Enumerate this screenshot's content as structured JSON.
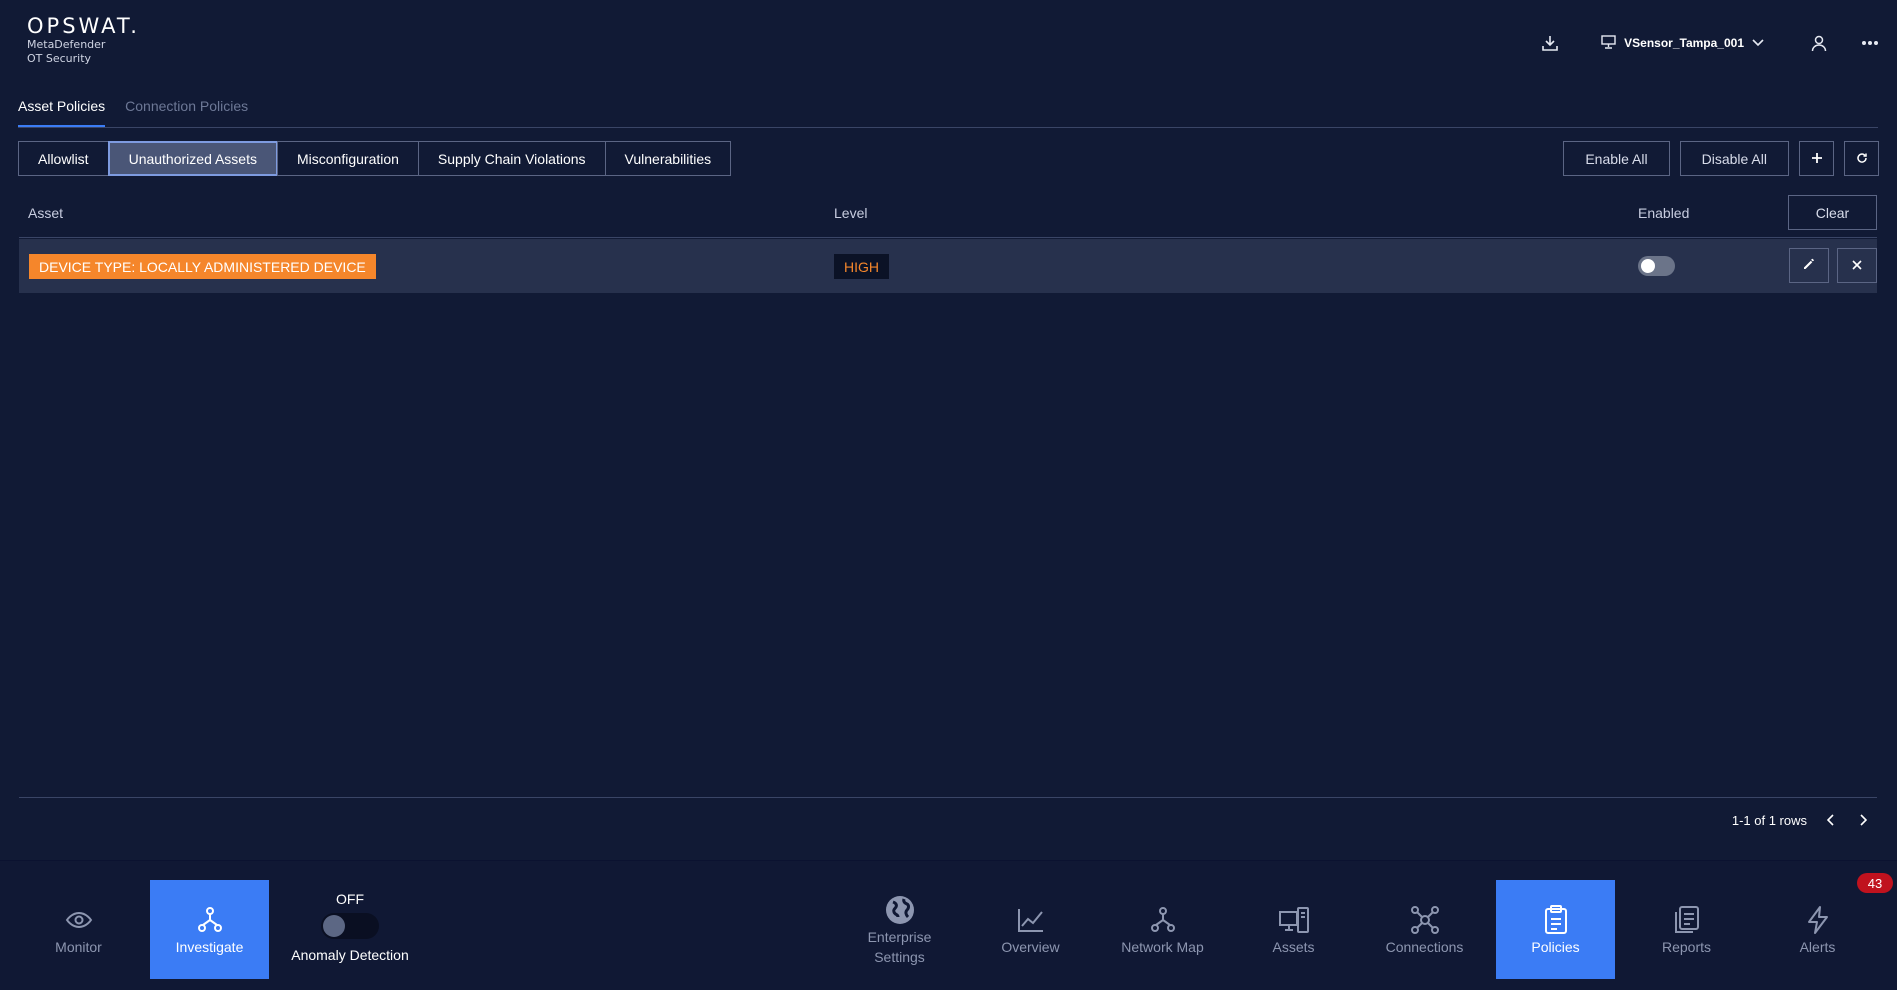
{
  "brand": {
    "name": "OPSWAT.",
    "product_line1": "MetaDefender",
    "product_line2": "OT Security"
  },
  "header": {
    "sensor_name": "VSensor_Tampa_001",
    "icons": [
      "download-icon",
      "monitor-icon",
      "chevron-down-icon",
      "user-icon",
      "more-icon"
    ]
  },
  "tabs": [
    {
      "label": "Asset Policies",
      "active": true
    },
    {
      "label": "Connection Policies",
      "active": false
    }
  ],
  "filters": [
    {
      "label": "Allowlist",
      "active": false
    },
    {
      "label": "Unauthorized Assets",
      "active": true
    },
    {
      "label": "Misconfiguration",
      "active": false
    },
    {
      "label": "Supply Chain Violations",
      "active": false
    },
    {
      "label": "Vulnerabilities",
      "active": false
    }
  ],
  "actions": {
    "enable_all": "Enable All",
    "disable_all": "Disable All",
    "add_icon": "plus-icon",
    "refresh_icon": "refresh-icon"
  },
  "table": {
    "columns": {
      "asset": "Asset",
      "level": "Level",
      "enabled": "Enabled"
    },
    "clear_label": "Clear",
    "rows": [
      {
        "asset": "DEVICE TYPE: LOCALLY ADMINISTERED DEVICE",
        "level": "HIGH",
        "enabled": false
      }
    ]
  },
  "pagination": {
    "text": "1-1 of 1 rows"
  },
  "nav": {
    "monitor": "Monitor",
    "investigate": "Investigate",
    "anomaly_state": "OFF",
    "anomaly_label": "Anomaly Detection",
    "enterprise_line1": "Enterprise",
    "enterprise_line2": "Settings",
    "overview": "Overview",
    "network_map": "Network Map",
    "assets": "Assets",
    "connections": "Connections",
    "policies": "Policies",
    "reports": "Reports",
    "alerts": "Alerts",
    "alerts_count": "43"
  },
  "colors": {
    "background": "#111a35",
    "accent": "#3b7cf5",
    "asset_tag": "#f5862b",
    "level_high": "#f5862b",
    "badge": "#c0121e"
  }
}
